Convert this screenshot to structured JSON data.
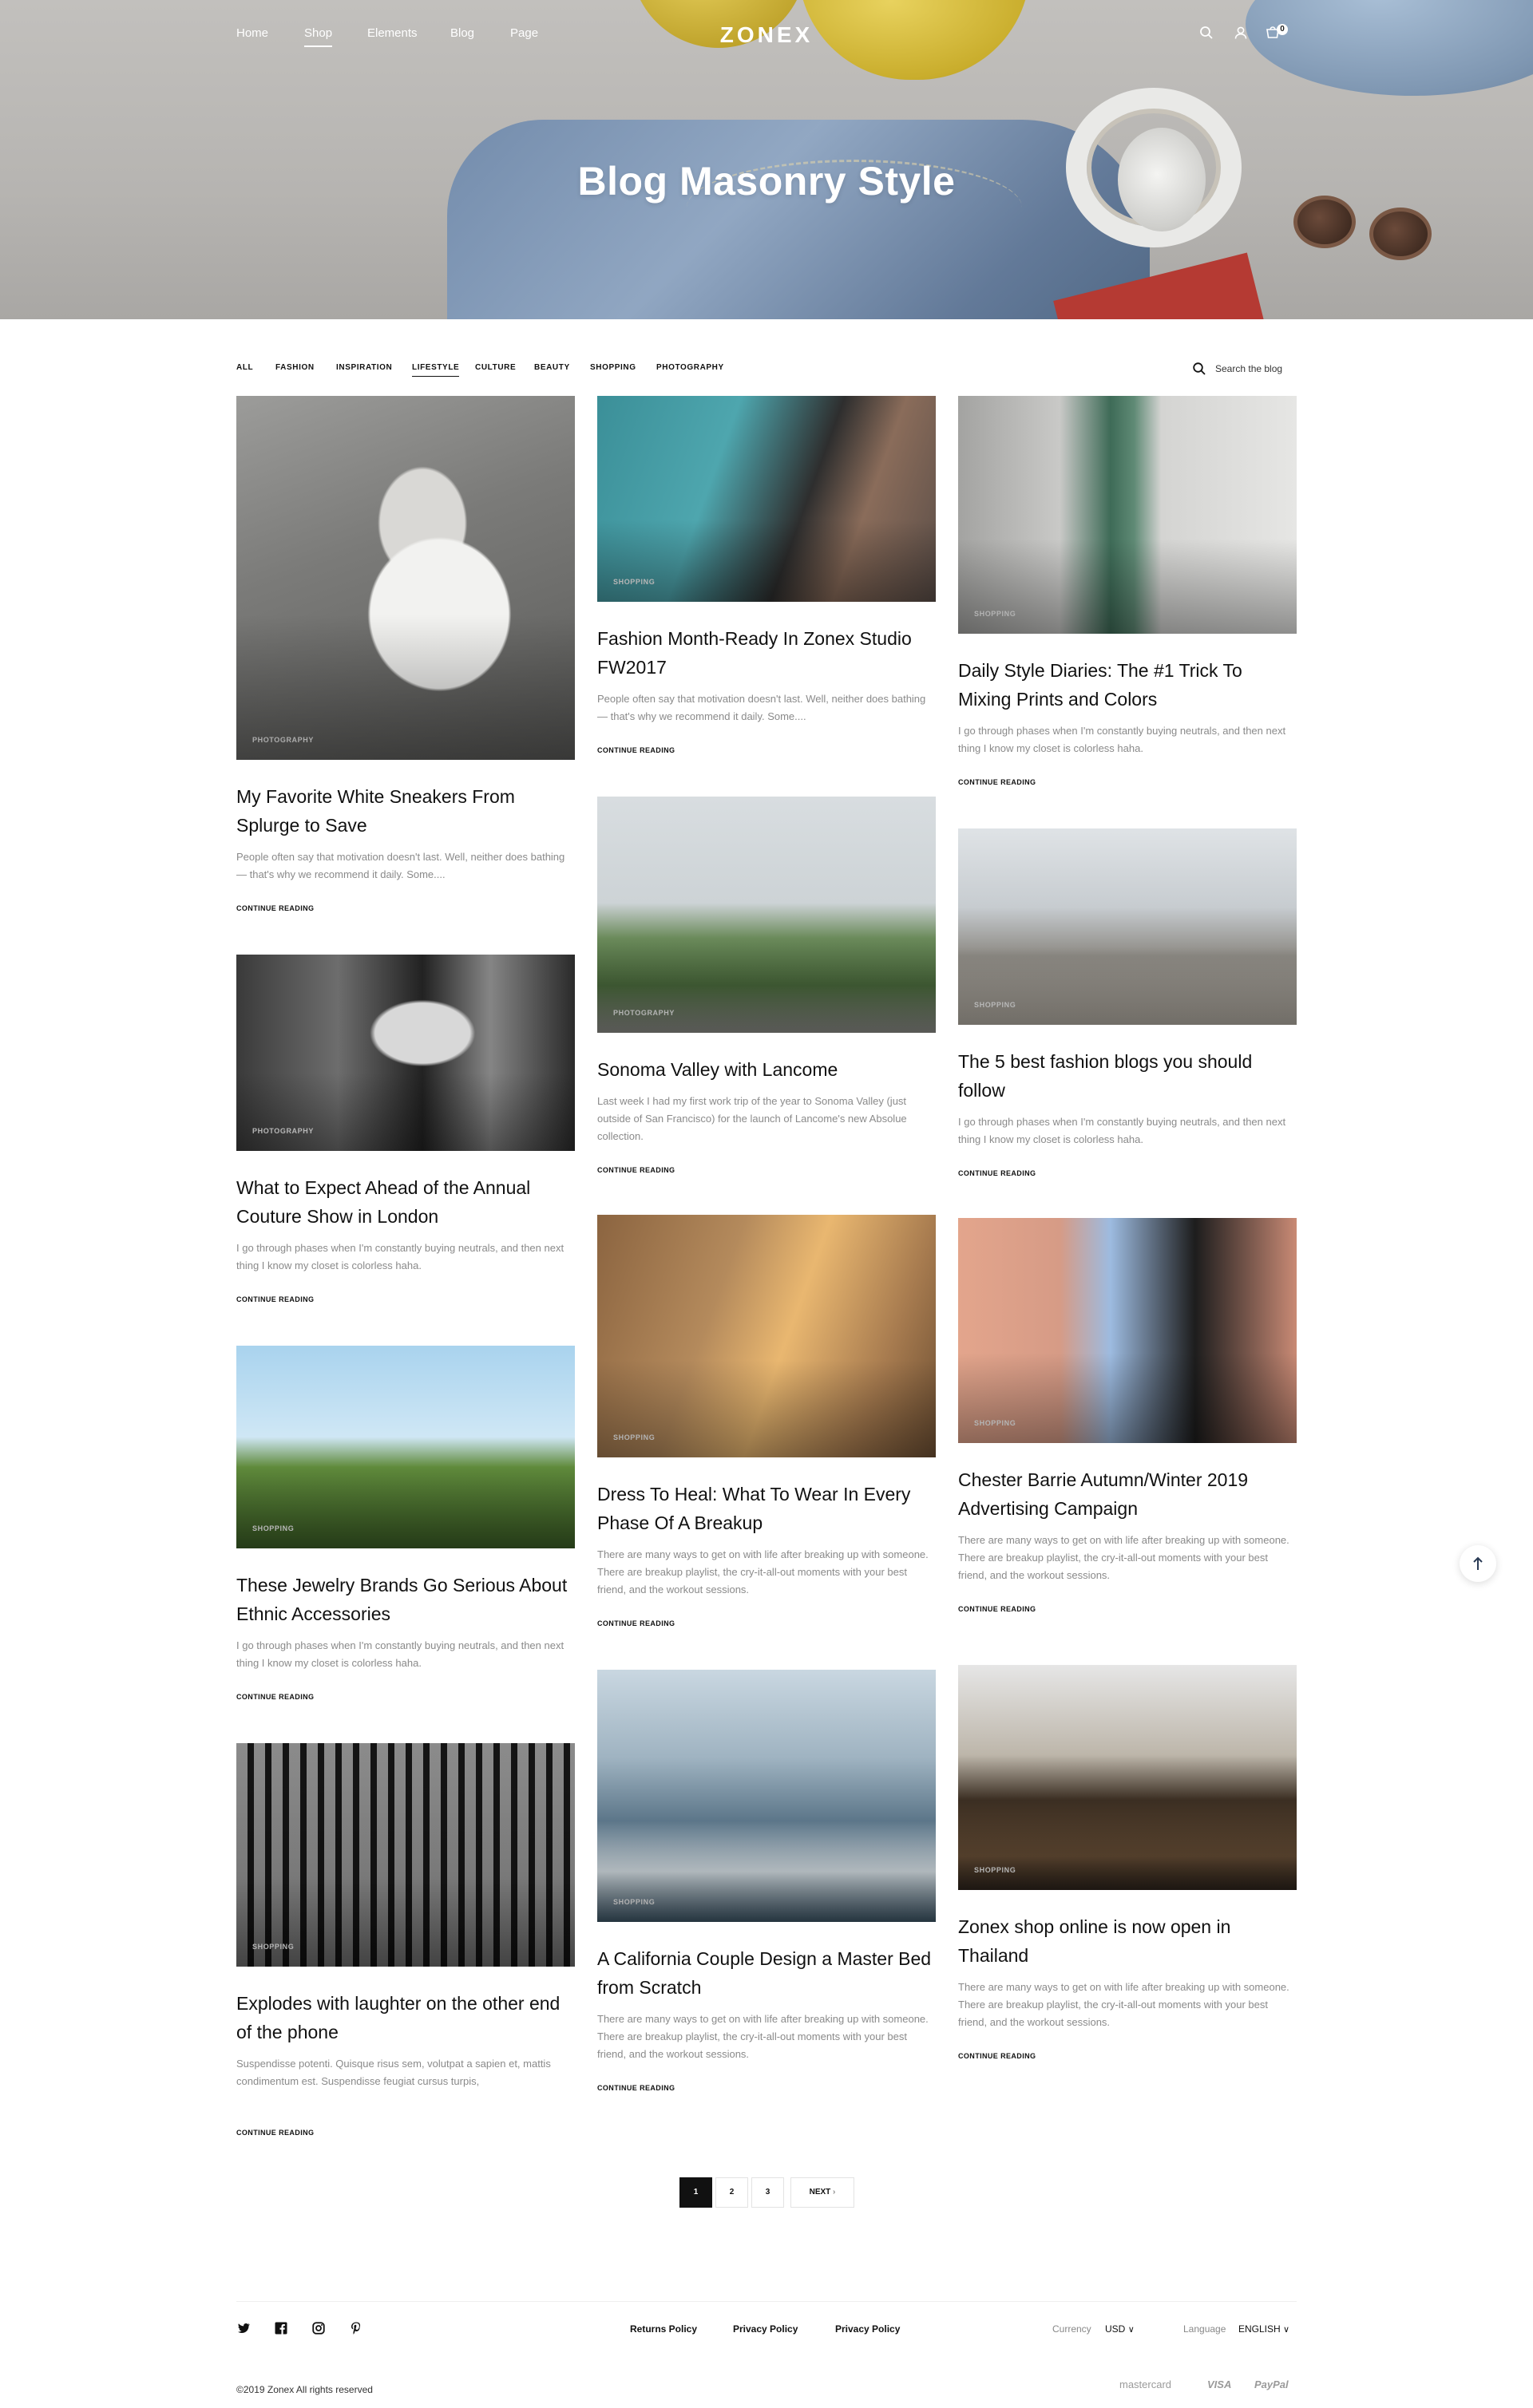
{
  "header": {
    "logo": "ZONEX",
    "nav": [
      "Home",
      "Shop",
      "Elements",
      "Blog",
      "Page"
    ],
    "active_nav": "Shop",
    "cart_count": "0"
  },
  "hero": {
    "title": "Blog Masonry Style"
  },
  "filters": {
    "items": [
      "ALL",
      "FASHION",
      "INSPIRATION",
      "LIFESTYLE",
      "CULTURE",
      "BEAUTY",
      "SHOPPING",
      "PHOTOGRAPHY"
    ],
    "active": "LIFESTYLE",
    "search_placeholder": "Search the blog"
  },
  "posts": [
    {
      "category": "PHOTOGRAPHY",
      "title": "My Favorite White Sneakers From Splurge to Save",
      "excerpt": "People often say that motivation doesn't last. Well, neither does bathing — that's why we recommend it daily. Some....",
      "more": "CONTINUE READING"
    },
    {
      "category": "SHOPPING",
      "title": "Fashion Month-Ready In Zonex Studio FW2017",
      "excerpt": "People often say that motivation doesn't last. Well, neither does bathing — that's why we recommend it daily. Some....",
      "more": "CONTINUE READING"
    },
    {
      "category": "SHOPPING",
      "title": "Daily Style Diaries: The #1 Trick To Mixing Prints and Colors",
      "excerpt": "I go through phases when I'm constantly buying neutrals, and then next thing I know my closet is colorless haha.",
      "more": "CONTINUE READING"
    },
    {
      "category": "PHOTOGRAPHY",
      "title": "What to Expect Ahead of the Annual Couture Show in London",
      "excerpt": "I go through phases when I'm constantly buying neutrals, and then next thing I know my closet is colorless haha.",
      "more": "CONTINUE READING"
    },
    {
      "category": "PHOTOGRAPHY",
      "title": "Sonoma Valley with Lancome",
      "excerpt": "Last week I had my first work trip of the year to Sonoma Valley (just outside of San Francisco) for the launch of Lancome's new Absolue collection.",
      "more": "CONTINUE READING"
    },
    {
      "category": "SHOPPING",
      "title": "The 5 best fashion blogs you should follow",
      "excerpt": "I go through phases when I'm constantly buying neutrals, and then next thing I know my closet is colorless haha.",
      "more": "CONTINUE READING"
    },
    {
      "category": "SHOPPING",
      "title": "These Jewelry Brands Go Serious About Ethnic Accessories",
      "excerpt": "I go through phases when I'm constantly buying neutrals, and then next thing I know my closet is colorless haha.",
      "more": "CONTINUE READING"
    },
    {
      "category": "SHOPPING",
      "title": "Dress To Heal: What To Wear In Every Phase Of A Breakup",
      "excerpt": "There are many ways to get on with life after breaking up with someone. There are breakup playlist, the cry-it-all-out moments with your best friend, and the workout sessions.",
      "more": "CONTINUE READING"
    },
    {
      "category": "SHOPPING",
      "title": "Chester Barrie Autumn/Winter 2019 Advertising Campaign",
      "excerpt": "There are many ways to get on with life after breaking up with someone. There are breakup playlist, the cry-it-all-out moments with your best friend, and the workout sessions.",
      "more": "CONTINUE READING"
    },
    {
      "category": "SHOPPING",
      "title": "Explodes with laughter on the other end of the phone",
      "excerpt": "Suspendisse potenti. Quisque risus sem, volutpat a sapien et, mattis condimentum est. Suspendisse feugiat cursus turpis,",
      "more": "CONTINUE READING"
    },
    {
      "category": "SHOPPING",
      "title": "A California Couple Design a Master Bed from Scratch",
      "excerpt": "There are many ways to get on with life after breaking up with someone. There are breakup playlist, the cry-it-all-out moments with your best friend, and the workout sessions.",
      "more": "CONTINUE READING"
    },
    {
      "category": "SHOPPING",
      "title": "Zonex shop online is now open in Thailand",
      "excerpt": "There are many ways to get on with life after breaking up with someone. There are breakup playlist, the cry-it-all-out moments with your best friend, and the workout sessions.",
      "more": "CONTINUE READING"
    }
  ],
  "pagination": {
    "pages": [
      "1",
      "2",
      "3"
    ],
    "current": "1",
    "next": "NEXT"
  },
  "footer": {
    "social_icons": [
      "twitter-icon",
      "facebook-icon",
      "instagram-icon",
      "pinterest-icon"
    ],
    "links": [
      "Returns Policy",
      "Privacy Policy",
      "Privacy Policy"
    ],
    "currency_label": "Currency",
    "currency_value": "USD",
    "language_label": "Language",
    "language_value": "ENGLISH",
    "copyright": "©2019 Zonex All rights reserved",
    "payments": [
      "mastercard",
      "VISA",
      "PayPal"
    ]
  }
}
